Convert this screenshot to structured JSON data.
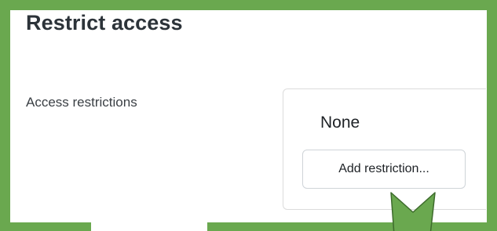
{
  "section": {
    "title": "Restrict access"
  },
  "field": {
    "label": "Access restrictions"
  },
  "restrictions": {
    "current_value": "None",
    "add_button_label": "Add restriction..."
  },
  "annotation": {
    "frame_color": "#6aa84f",
    "arrow_color": "#6aa84f",
    "arrow_stroke": "#3d6b2c",
    "arrow_icon": "arrow-down-icon"
  }
}
